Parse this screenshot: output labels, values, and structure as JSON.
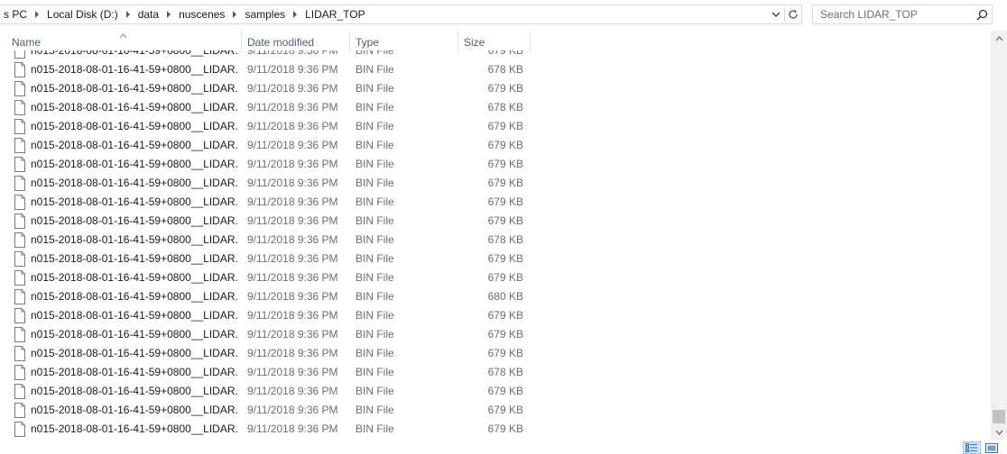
{
  "breadcrumb": {
    "items": [
      "s PC",
      "Local Disk (D:)",
      "data",
      "nuscenes",
      "samples",
      "LIDAR_TOP"
    ]
  },
  "search": {
    "placeholder": "Search LIDAR_TOP"
  },
  "columns": {
    "name": "Name",
    "date": "Date modified",
    "type": "Type",
    "size": "Size"
  },
  "files": {
    "partial_top": {
      "name": "n015-2018-08-01-16-41-59+0800__LIDAR...",
      "date": "9/11/2018 9:36 PM",
      "type": "BIN File",
      "size": "679 KB"
    },
    "rows": [
      {
        "name": "n015-2018-08-01-16-41-59+0800__LIDAR...",
        "date": "9/11/2018 9:36 PM",
        "type": "BIN File",
        "size": "678 KB"
      },
      {
        "name": "n015-2018-08-01-16-41-59+0800__LIDAR...",
        "date": "9/11/2018 9:36 PM",
        "type": "BIN File",
        "size": "679 KB"
      },
      {
        "name": "n015-2018-08-01-16-41-59+0800__LIDAR...",
        "date": "9/11/2018 9:36 PM",
        "type": "BIN File",
        "size": "678 KB"
      },
      {
        "name": "n015-2018-08-01-16-41-59+0800__LIDAR...",
        "date": "9/11/2018 9:36 PM",
        "type": "BIN File",
        "size": "679 KB"
      },
      {
        "name": "n015-2018-08-01-16-41-59+0800__LIDAR...",
        "date": "9/11/2018 9:36 PM",
        "type": "BIN File",
        "size": "679 KB"
      },
      {
        "name": "n015-2018-08-01-16-41-59+0800__LIDAR...",
        "date": "9/11/2018 9:36 PM",
        "type": "BIN File",
        "size": "679 KB"
      },
      {
        "name": "n015-2018-08-01-16-41-59+0800__LIDAR...",
        "date": "9/11/2018 9:36 PM",
        "type": "BIN File",
        "size": "679 KB"
      },
      {
        "name": "n015-2018-08-01-16-41-59+0800__LIDAR...",
        "date": "9/11/2018 9:36 PM",
        "type": "BIN File",
        "size": "679 KB"
      },
      {
        "name": "n015-2018-08-01-16-41-59+0800__LIDAR...",
        "date": "9/11/2018 9:36 PM",
        "type": "BIN File",
        "size": "679 KB"
      },
      {
        "name": "n015-2018-08-01-16-41-59+0800__LIDAR...",
        "date": "9/11/2018 9:36 PM",
        "type": "BIN File",
        "size": "678 KB"
      },
      {
        "name": "n015-2018-08-01-16-41-59+0800__LIDAR...",
        "date": "9/11/2018 9:36 PM",
        "type": "BIN File",
        "size": "679 KB"
      },
      {
        "name": "n015-2018-08-01-16-41-59+0800__LIDAR...",
        "date": "9/11/2018 9:36 PM",
        "type": "BIN File",
        "size": "679 KB"
      },
      {
        "name": "n015-2018-08-01-16-41-59+0800__LIDAR...",
        "date": "9/11/2018 9:36 PM",
        "type": "BIN File",
        "size": "680 KB"
      },
      {
        "name": "n015-2018-08-01-16-41-59+0800__LIDAR...",
        "date": "9/11/2018 9:36 PM",
        "type": "BIN File",
        "size": "679 KB"
      },
      {
        "name": "n015-2018-08-01-16-41-59+0800__LIDAR...",
        "date": "9/11/2018 9:36 PM",
        "type": "BIN File",
        "size": "679 KB"
      },
      {
        "name": "n015-2018-08-01-16-41-59+0800__LIDAR...",
        "date": "9/11/2018 9:36 PM",
        "type": "BIN File",
        "size": "679 KB"
      },
      {
        "name": "n015-2018-08-01-16-41-59+0800__LIDAR...",
        "date": "9/11/2018 9:36 PM",
        "type": "BIN File",
        "size": "678 KB"
      },
      {
        "name": "n015-2018-08-01-16-41-59+0800__LIDAR...",
        "date": "9/11/2018 9:36 PM",
        "type": "BIN File",
        "size": "679 KB"
      },
      {
        "name": "n015-2018-08-01-16-41-59+0800__LIDAR...",
        "date": "9/11/2018 9:36 PM",
        "type": "BIN File",
        "size": "679 KB"
      },
      {
        "name": "n015-2018-08-01-16-41-59+0800__LIDAR...",
        "date": "9/11/2018 9:36 PM",
        "type": "BIN File",
        "size": "679 KB"
      }
    ]
  },
  "icons": {
    "breadcrumb_separator": "chevron-right-icon",
    "address_dropdown": "chevron-down-icon",
    "refresh": "refresh-icon",
    "search": "search-icon",
    "sort": "sort-ascending-icon",
    "file": "file-icon",
    "view_details": "details-view-icon",
    "view_large": "large-icons-view-icon"
  },
  "colors": {
    "header_text": "#4c607a",
    "secondary_text": "#6d6d6d",
    "selected_view": "#cce8ff"
  }
}
